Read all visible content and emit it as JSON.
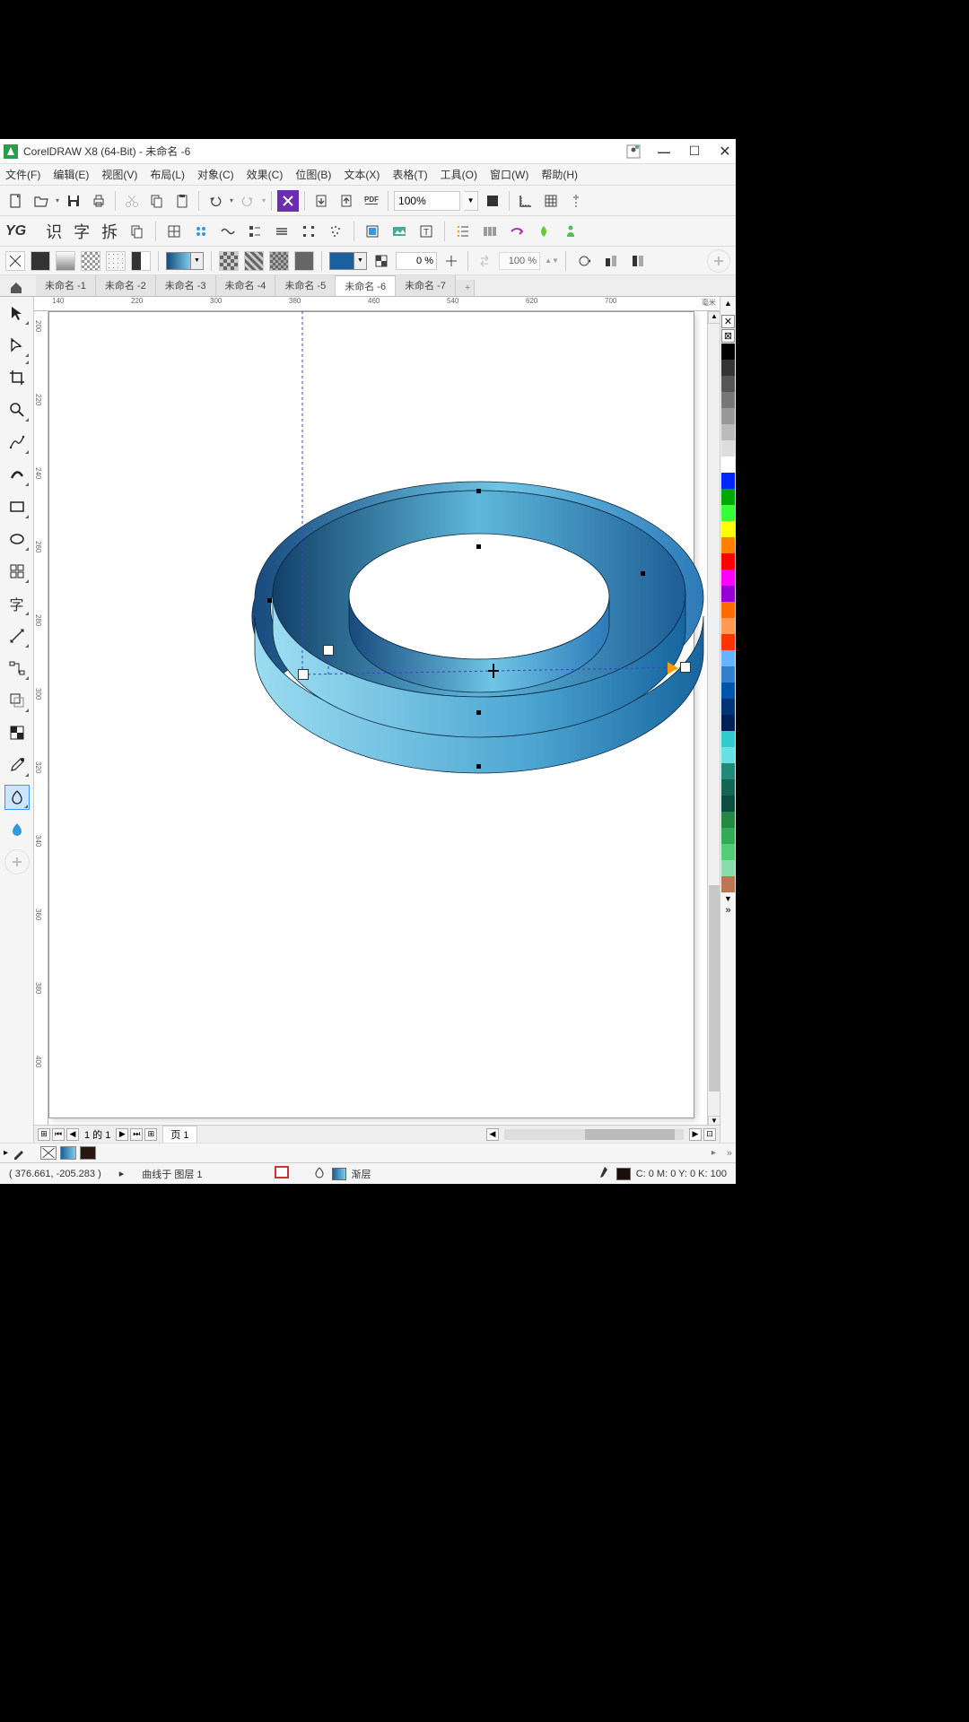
{
  "title": "CorelDRAW X8 (64-Bit) - 未命名 -6",
  "menu": [
    "文件(F)",
    "编辑(E)",
    "视图(V)",
    "布局(L)",
    "对象(C)",
    "效果(C)",
    "位图(B)",
    "文本(X)",
    "表格(T)",
    "工具(O)",
    "窗口(W)",
    "帮助(H)"
  ],
  "zoom": "100%",
  "toolbar2": {
    "yg": "YG",
    "cn": "识 字 拆"
  },
  "propbar": {
    "pct1": "0 %",
    "pct2": "100 %"
  },
  "tabs": [
    "未命名 -1",
    "未命名 -2",
    "未命名 -3",
    "未命名 -4",
    "未命名 -5",
    "未命名 -6",
    "未命名 -7"
  ],
  "active_tab": 5,
  "ruler_h": [
    140,
    220,
    300,
    380,
    460,
    540,
    620,
    700
  ],
  "ruler_h_unit": "毫米",
  "ruler_v": [
    200,
    220,
    240,
    260,
    280,
    300,
    320,
    340,
    360,
    380,
    400
  ],
  "page_nav": {
    "counter": "1 的 1",
    "tab": "页 1"
  },
  "status": {
    "coords": "( 376.661, -205.283 )",
    "arrow": "▸",
    "object": "曲线于 图层 1",
    "fill_label": "渐层",
    "cmyk": "C: 0 M: 0 Y: 0 K: 100"
  },
  "fill_color_box": "#1a5f9e",
  "grad_box": "linear-gradient(90deg,#1a5f9e,#7ecce8)",
  "palette": [
    "#000000",
    "#333333",
    "#555555",
    "#777777",
    "#999999",
    "#bbbbbb",
    "#dddddd",
    "#ffffff",
    "#0026ff",
    "#00a800",
    "#37ff37",
    "#ffff00",
    "#ff7f00",
    "#ff0000",
    "#ff00ff",
    "#9400d3",
    "#ff6a00",
    "#ff9955",
    "#ff3300",
    "#66b3ff",
    "#3380cc",
    "#0055aa",
    "#003377",
    "#001f55",
    "#33cccc",
    "#66e0e0",
    "#228877",
    "#116655",
    "#0b4d3f",
    "#228844",
    "#33aa55",
    "#55cc77",
    "#88ddaa",
    "#bb7755"
  ],
  "colors": {
    "gradient_fill_start": "#17497d",
    "gradient_fill_end": "#7ecce8"
  }
}
